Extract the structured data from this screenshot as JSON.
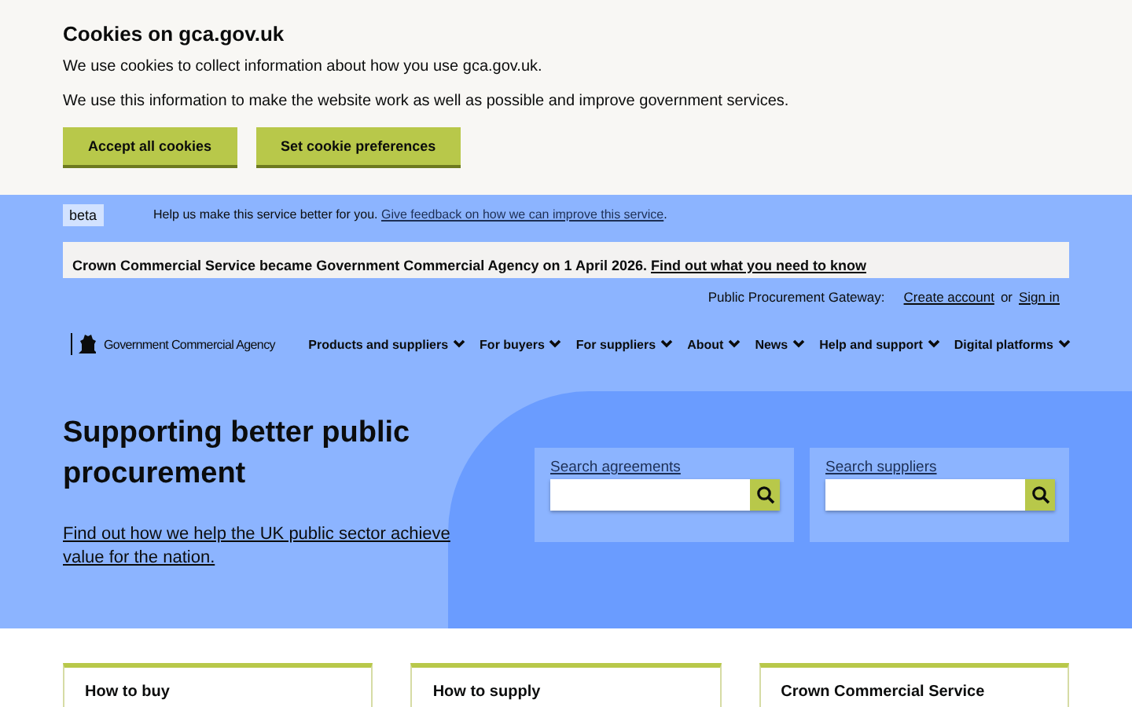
{
  "cookie_banner": {
    "title": "Cookies on gca.gov.uk",
    "paragraphs": [
      "We use cookies to collect information about how you use gca.gov.uk.",
      "We use this information to make the website work as well as possible and improve government services."
    ],
    "buttons": [
      "Accept all cookies",
      "Set cookie preferences"
    ]
  },
  "phase_banner": {
    "tag": "beta",
    "text": "Help us make this service better for you.",
    "link": "Give feedback on how we can improve this service",
    "after": "."
  },
  "notice": {
    "text": "Crown Commercial Service became Government Commercial Agency on 1 April 2026.",
    "link": "Find out what you need to know"
  },
  "account_bar": {
    "label": "Public Procurement Gateway:",
    "links": [
      "Create account",
      "Sign in"
    ],
    "separator": "or"
  },
  "header": {
    "logo_text": "Government Commercial Agency",
    "nav": [
      "Products and suppliers",
      "For buyers",
      "For suppliers",
      "About",
      "News",
      "Help and support",
      "Digital platforms"
    ]
  },
  "hero": {
    "title": "Supporting better public procurement",
    "link": "Find out how we help the UK public sector achieve value for the nation.",
    "searches": [
      {
        "label": "Search agreements"
      },
      {
        "label": "Search suppliers"
      }
    ]
  },
  "cards": [
    {
      "title": "How to buy"
    },
    {
      "title": "How to supply"
    },
    {
      "title": "Crown Commercial Service"
    }
  ]
}
